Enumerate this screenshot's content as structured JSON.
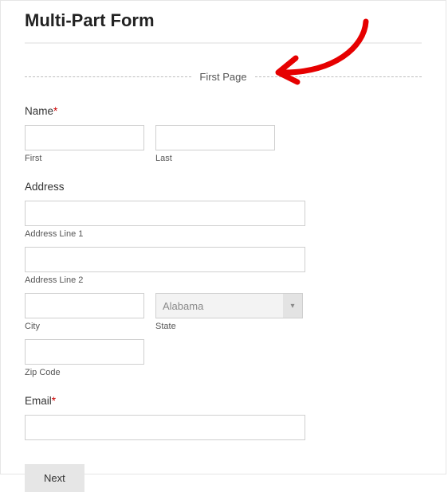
{
  "title": "Multi-Part Form",
  "page_break_label": "First Page",
  "name": {
    "label": "Name",
    "required_mark": "*",
    "first_sub": "First",
    "last_sub": "Last",
    "first_value": "",
    "last_value": ""
  },
  "address": {
    "label": "Address",
    "line1_sub": "Address Line 1",
    "line2_sub": "Address Line 2",
    "city_sub": "City",
    "state_sub": "State",
    "zip_sub": "Zip Code",
    "line1_value": "",
    "line2_value": "",
    "city_value": "",
    "state_selected": "Alabama",
    "zip_value": ""
  },
  "email": {
    "label": "Email",
    "required_mark": "*",
    "value": ""
  },
  "next_button": "Next",
  "annotation_color": "#e60000"
}
